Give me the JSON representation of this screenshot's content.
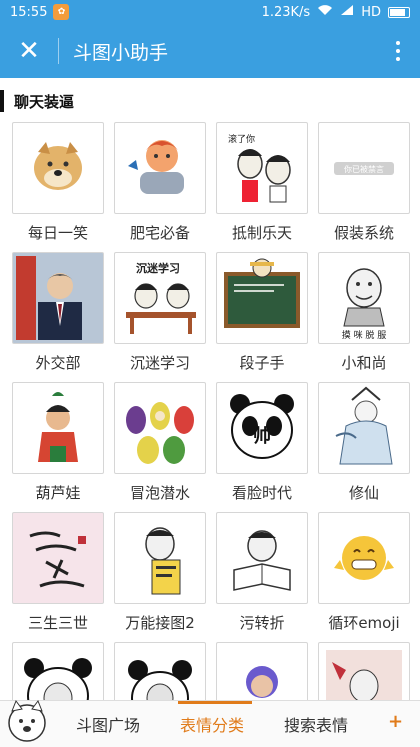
{
  "status_bar": {
    "time": "15:55",
    "network_speed": "1.23K/s",
    "network_type": "HD",
    "icons": [
      "app-badge-icon",
      "wifi-icon",
      "signal-icon",
      "battery-icon"
    ]
  },
  "title_bar": {
    "title": "斗图小助手",
    "close_icon": "close-icon",
    "more_icon": "more-vertical-icon"
  },
  "section": {
    "title": "聊天装逼"
  },
  "stickers": [
    {
      "label": "每日一笑",
      "text": ""
    },
    {
      "label": "肥宅必备",
      "text": ""
    },
    {
      "label": "抵制乐天",
      "text": "滚了你"
    },
    {
      "label": "假装系统",
      "text": "你已被禁言"
    },
    {
      "label": "外交部",
      "text": ""
    },
    {
      "label": "沉迷学习",
      "text": "沉迷学习"
    },
    {
      "label": "段子手",
      "text": ""
    },
    {
      "label": "小和尚",
      "text": "摸 咪 脱 服"
    },
    {
      "label": "葫芦娃",
      "text": ""
    },
    {
      "label": "冒泡潜水",
      "text": ""
    },
    {
      "label": "看脸时代",
      "text": "帅"
    },
    {
      "label": "修仙",
      "text": ""
    },
    {
      "label": "三生三世",
      "text": ""
    },
    {
      "label": "万能接图2",
      "text": ""
    },
    {
      "label": "污转折",
      "text": ""
    },
    {
      "label": "循环emoji",
      "text": ""
    },
    {
      "label": "",
      "text": ""
    },
    {
      "label": "",
      "text": ""
    },
    {
      "label": "",
      "text": ""
    },
    {
      "label": "",
      "text": ""
    }
  ],
  "tab_bar": {
    "tabs": [
      {
        "label": "斗图广场",
        "active": false
      },
      {
        "label": "表情分类",
        "active": true
      },
      {
        "label": "搜索表情",
        "active": false
      }
    ],
    "plus": "+"
  },
  "colors": {
    "header_blue": "#3a9fe0",
    "accent_orange": "#e07b1a",
    "border_grey": "#d6d6d6"
  }
}
